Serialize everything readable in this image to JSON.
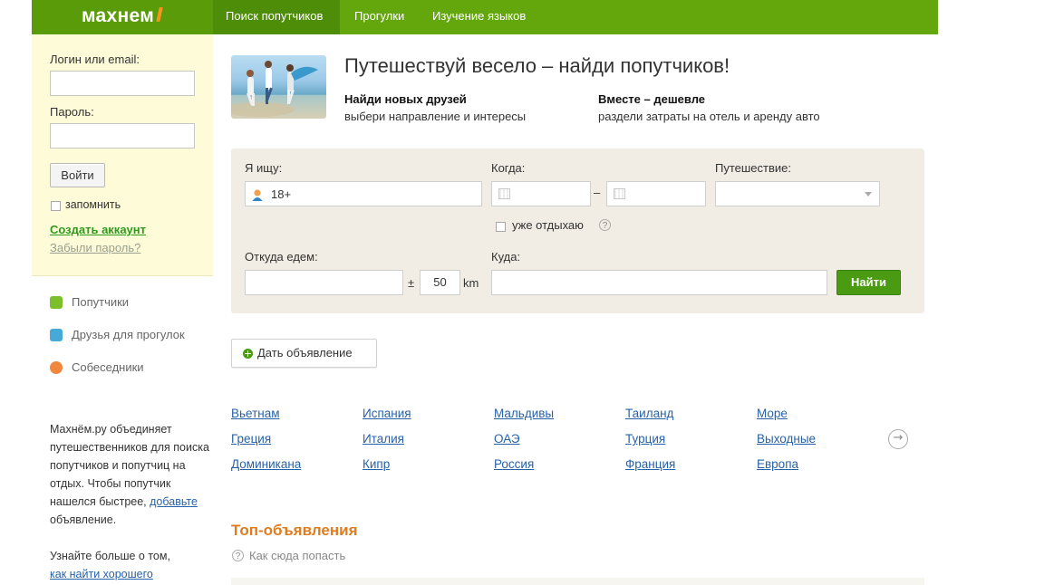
{
  "brand": {
    "name": "махнем",
    "accent": "#f7941d",
    "nav_bg": "#64a70d"
  },
  "nav": {
    "tabs": [
      {
        "label": "Поиск попутчиков",
        "active": true
      },
      {
        "label": "Прогулки",
        "active": false
      },
      {
        "label": "Изучение языков",
        "active": false
      }
    ]
  },
  "login": {
    "login_label": "Логин или email:",
    "password_label": "Пароль:",
    "login_button": "Войти",
    "remember_label": "запомнить",
    "create_account": "Создать аккаунт",
    "forgot_password": "Забыли пароль?"
  },
  "sidebar_nav": [
    {
      "label": "Попутчики",
      "icon": "suitcase-icon",
      "color": "#7cbf2a"
    },
    {
      "label": "Друзья для прогулок",
      "icon": "walk-icon",
      "color": "#46a9d8"
    },
    {
      "label": "Собеседники",
      "icon": "chat-icon",
      "color": "#f0873c"
    }
  ],
  "about": {
    "line1": "Махнём.ру объединяет путешественников для поиска попутчиков и попутчиц на отдых. Чтобы попутчик нашелся быстрее, ",
    "link1": "добавьте",
    "line2": " объявление.",
    "line3": "Узнайте больше о том, ",
    "link2": "как найти хорошего"
  },
  "hero": {
    "title": "Путешествуй весело – найди попутчиков!",
    "features": [
      {
        "heading": "Найди новых друзей",
        "text": "выбери направление и интересы"
      },
      {
        "heading": "Вместе – дешевле",
        "text": "раздели затраты на отель и аренду авто"
      }
    ]
  },
  "search": {
    "looking_label": "Я ищу:",
    "looking_value": "18+",
    "when_label": "Когда:",
    "date_separator": "–",
    "travel_label": "Путешествие:",
    "already_resting_label": "уже отдыхаю",
    "help_mark": "?",
    "from_label": "Откуда едем:",
    "radius_prefix": "±",
    "radius_value": "50",
    "radius_unit": "km",
    "to_label": "Куда:",
    "find_button": "Найти"
  },
  "add_ad_button": "Дать объявление",
  "destinations": [
    [
      "Вьетнам",
      "Испания",
      "Мальдивы",
      "Таиланд",
      "Море"
    ],
    [
      "Греция",
      "Италия",
      "ОАЭ",
      "Турция",
      "Выходные"
    ],
    [
      "Доминикана",
      "Кипр",
      "Россия",
      "Франция",
      "Европа"
    ]
  ],
  "top_ads": {
    "title": "Топ-объявления",
    "help": "Как сюда попасть",
    "help_mark": "?"
  }
}
